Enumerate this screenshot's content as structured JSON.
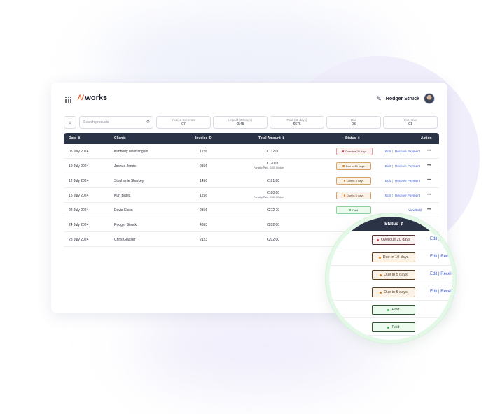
{
  "brand": {
    "mark": "/\\/",
    "name": "works"
  },
  "user": {
    "name": "Rodger Struck"
  },
  "search": {
    "placeholder": "Search products"
  },
  "stats": [
    {
      "label": "Invoice Generate",
      "value": "07"
    },
    {
      "label": "Unpaid (30 days)",
      "value": "€545"
    },
    {
      "label": "Paid (30 days)",
      "value": "€676"
    },
    {
      "label": "Due",
      "value": "03"
    },
    {
      "label": "Over Due",
      "value": "01"
    }
  ],
  "table": {
    "headers": {
      "date": "Date",
      "clients": "Clients",
      "invoice_id": "Invoice ID",
      "total_amount": "Total Amount",
      "status": "Status",
      "action": "Action"
    },
    "rows": [
      {
        "date": "05 July 2024",
        "client": "Kimberly Mastrangelo",
        "invoice": "1226",
        "amount": "€132.00",
        "sub": "",
        "status": "Overdue 20 days",
        "kind": "overdue",
        "edit": "Edit",
        "sep": "|",
        "receive": "Receive Payment"
      },
      {
        "date": "10 July 2024",
        "client": "Joshua Jones",
        "invoice": "2356",
        "amount": "€120.00",
        "sub": "Partially Paid, €100.00 due",
        "status": "Due in 10 days",
        "kind": "due",
        "edit": "Edit",
        "sep": "|",
        "receive": "Receive Payment"
      },
      {
        "date": "12 July 2024",
        "client": "Stephanie Sharkey",
        "invoice": "1456",
        "amount": "€181.80",
        "sub": "",
        "status": "Due in 5 days",
        "kind": "due",
        "edit": "Edit",
        "sep": "|",
        "receive": "Receive Payment"
      },
      {
        "date": "15 July 2024",
        "client": "Kurt Bates",
        "invoice": "1256",
        "amount": "€180.00",
        "sub": "Partially Paid, €100.00 due",
        "status": "Due in 5 days",
        "kind": "due",
        "edit": "Edit",
        "sep": "|",
        "receive": "Receive Payment"
      },
      {
        "date": "22 July 2024",
        "client": "David Elson",
        "invoice": "2356",
        "amount": "€272.70",
        "sub": "",
        "status": "Paid",
        "kind": "paid",
        "view": "View/Edit"
      },
      {
        "date": "24 July 2024",
        "client": "Rodger Struck",
        "invoice": "4653",
        "amount": "€202.00",
        "sub": "",
        "status": "",
        "kind": ""
      },
      {
        "date": "28 July 2024",
        "client": "Chris Glasser",
        "invoice": "2123",
        "amount": "€202.00",
        "sub": "",
        "status": "",
        "kind": ""
      }
    ]
  },
  "zoom": {
    "header": "Status",
    "rows": [
      {
        "status": "Overdue 20 days",
        "kind": "overdue",
        "action": "Edit |"
      },
      {
        "status": "Due in 10 days",
        "kind": "due",
        "action": "Edit | Recei"
      },
      {
        "status": "Due in 5 days",
        "kind": "due",
        "action": "Edit | Recei"
      },
      {
        "status": "Due in 5 days",
        "kind": "due",
        "action": "Edit | Recei"
      },
      {
        "status": "Paid",
        "kind": "paid",
        "action": ""
      },
      {
        "status": "Paid",
        "kind": "paid",
        "action": ""
      }
    ]
  },
  "colors": {
    "header_bg": "#2b3347",
    "link": "#3c5bd3",
    "overdue": "#d9434e",
    "due": "#d8801f",
    "paid": "#3bb34f",
    "brand_accent": "#e0592a"
  }
}
